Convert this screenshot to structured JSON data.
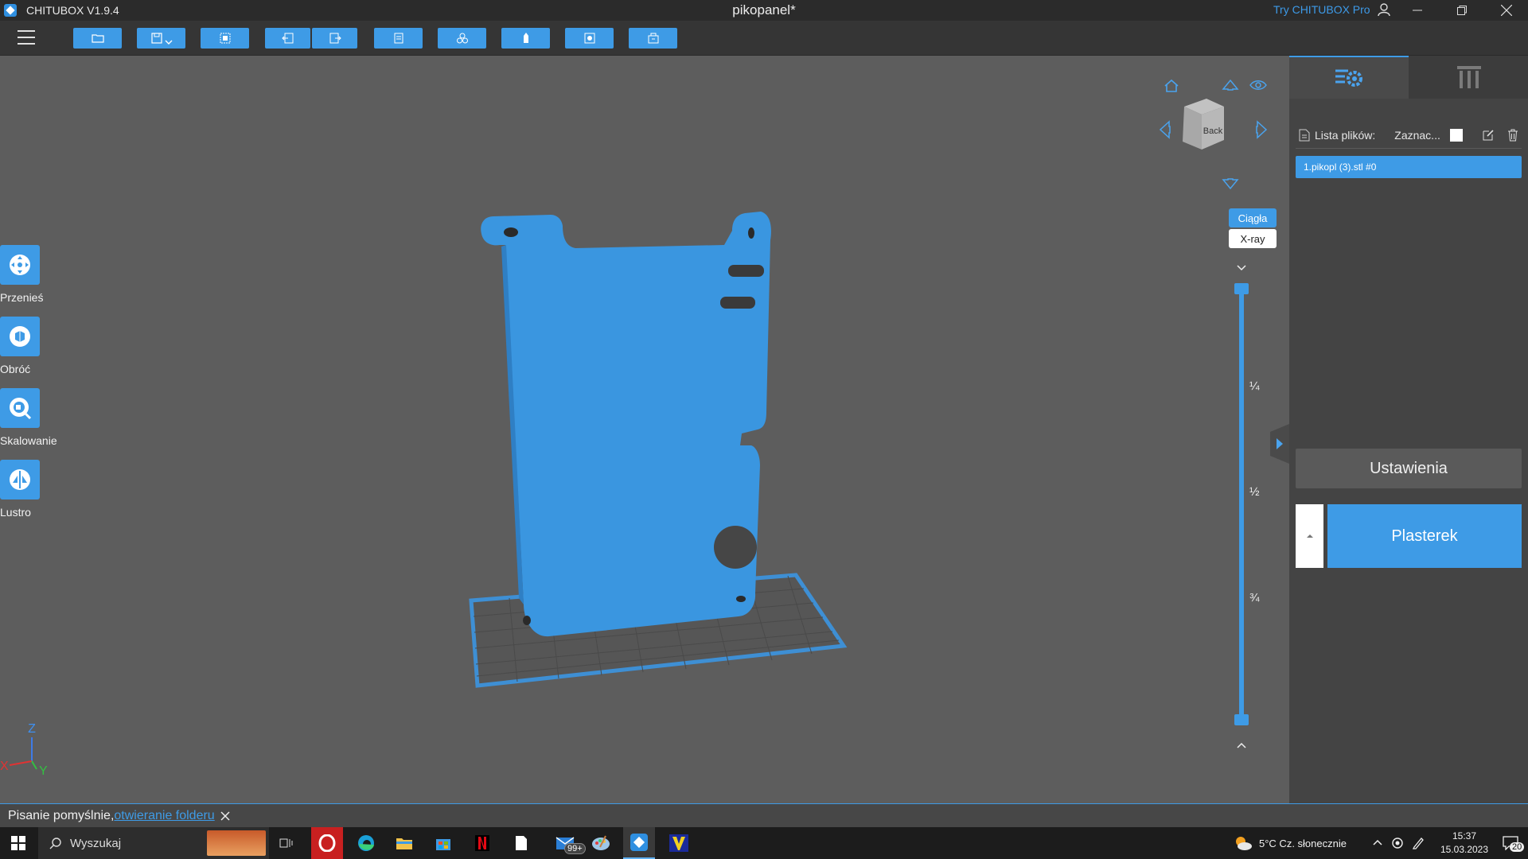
{
  "window": {
    "app_name": "CHITUBOX V1.9.4",
    "document_title": "pikopanel*",
    "try_pro": "Try CHITUBOX Pro"
  },
  "colors": {
    "accent": "#3e9be6",
    "model": "#3a96e0",
    "background": "#5d5d5d"
  },
  "toolbar": {
    "icons": [
      "open-file-icon",
      "save-icon",
      "select-all-icon",
      "undo-icon",
      "redo-icon",
      "layout-icon",
      "hollow-icon",
      "support-icon",
      "drill-icon",
      "screenshot-icon"
    ]
  },
  "left_tools": [
    {
      "label": "Przenieś",
      "icon": "move-icon"
    },
    {
      "label": "Obróć",
      "icon": "rotate-icon"
    },
    {
      "label": "Skalowanie",
      "icon": "scale-icon"
    },
    {
      "label": "Lustro",
      "icon": "mirror-icon"
    }
  ],
  "viewcube": {
    "face_label": "Back"
  },
  "view_modes": {
    "solid": "Ciągła",
    "xray": "X-ray"
  },
  "layer_slider": {
    "marks": [
      "¼",
      "½",
      "¾"
    ]
  },
  "axes": {
    "z": "Z",
    "x": "X",
    "y": "Y"
  },
  "right_panel": {
    "file_list_label": "Lista plików:",
    "select_label": "Zaznac...",
    "files": [
      "1.pikopl (3).stl #0"
    ],
    "settings_button": "Ustawienia",
    "slice_button": "Plasterek"
  },
  "status": {
    "message": "Pisanie pomyślnie,",
    "link": "otwieranie folderu"
  },
  "taskbar": {
    "search_placeholder": "Wyszukaj",
    "mail_badge": "99+",
    "weather": "5°C  Cz. słonecznie",
    "time": "15:37",
    "date": "15.03.2023",
    "notifications": "20"
  }
}
